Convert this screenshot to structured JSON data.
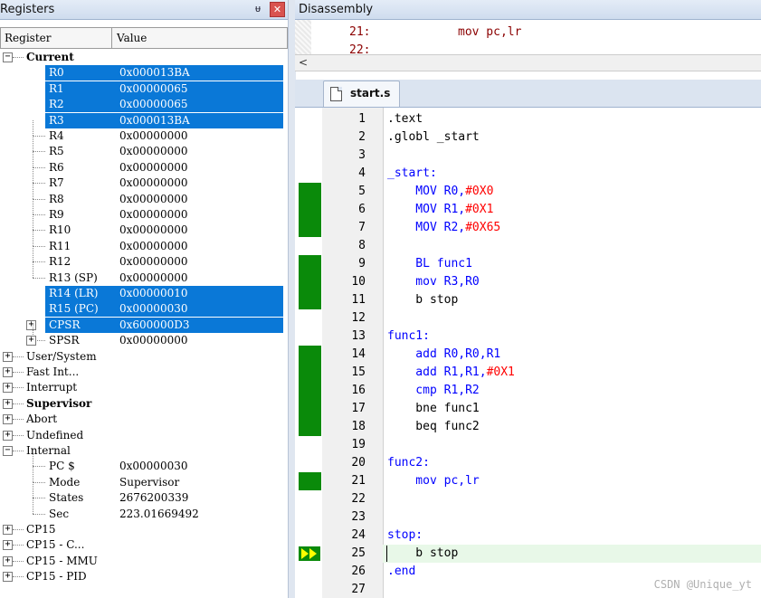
{
  "registers_panel": {
    "title": "Registers",
    "pin_glyph": "ᵾ",
    "close_glyph": "✕",
    "columns": {
      "register": "Register",
      "value": "Value"
    }
  },
  "tree": [
    {
      "name": "Current",
      "value": "",
      "bold": true,
      "expander": "−",
      "level": 1,
      "selected": false
    },
    {
      "name": "R0",
      "value": "0x000013BA",
      "level": 2,
      "selected": true
    },
    {
      "name": "R1",
      "value": "0x00000065",
      "level": 2,
      "selected": true
    },
    {
      "name": "R2",
      "value": "0x00000065",
      "level": 2,
      "selected": true
    },
    {
      "name": "R3",
      "value": "0x000013BA",
      "level": 2,
      "selected": true
    },
    {
      "name": "R4",
      "value": "0x00000000",
      "level": 2,
      "selected": false
    },
    {
      "name": "R5",
      "value": "0x00000000",
      "level": 2,
      "selected": false
    },
    {
      "name": "R6",
      "value": "0x00000000",
      "level": 2,
      "selected": false
    },
    {
      "name": "R7",
      "value": "0x00000000",
      "level": 2,
      "selected": false
    },
    {
      "name": "R8",
      "value": "0x00000000",
      "level": 2,
      "selected": false
    },
    {
      "name": "R9",
      "value": "0x00000000",
      "level": 2,
      "selected": false
    },
    {
      "name": "R10",
      "value": "0x00000000",
      "level": 2,
      "selected": false
    },
    {
      "name": "R11",
      "value": "0x00000000",
      "level": 2,
      "selected": false
    },
    {
      "name": "R12",
      "value": "0x00000000",
      "level": 2,
      "selected": false
    },
    {
      "name": "R13 (SP)",
      "value": "0x00000000",
      "level": 2,
      "selected": false
    },
    {
      "name": "R14 (LR)",
      "value": "0x00000010",
      "level": 2,
      "selected": true
    },
    {
      "name": "R15 (PC)",
      "value": "0x00000030",
      "level": 2,
      "selected": true
    },
    {
      "name": "CPSR",
      "value": "0x600000D3",
      "level": 2,
      "selected": true,
      "expander": "+"
    },
    {
      "name": "SPSR",
      "value": "0x00000000",
      "level": 2,
      "selected": false,
      "expander": "+"
    },
    {
      "name": "User/System",
      "value": "",
      "level": 1,
      "expander": "+"
    },
    {
      "name": "Fast Int...",
      "value": "",
      "level": 1,
      "expander": "+"
    },
    {
      "name": "Interrupt",
      "value": "",
      "level": 1,
      "expander": "+"
    },
    {
      "name": "Supervisor",
      "value": "",
      "level": 1,
      "expander": "+",
      "bold": true
    },
    {
      "name": "Abort",
      "value": "",
      "level": 1,
      "expander": "+"
    },
    {
      "name": "Undefined",
      "value": "",
      "level": 1,
      "expander": "+"
    },
    {
      "name": "Internal",
      "value": "",
      "level": 1,
      "expander": "−"
    },
    {
      "name": "PC  $",
      "value": "0x00000030",
      "level": 2,
      "selected": false
    },
    {
      "name": "Mode",
      "value": "Supervisor",
      "level": 2,
      "selected": false
    },
    {
      "name": "States",
      "value": "2676200339",
      "level": 2,
      "selected": false
    },
    {
      "name": "Sec",
      "value": "223.01669492",
      "level": 2,
      "selected": false
    },
    {
      "name": "CP15",
      "value": "",
      "level": 1,
      "expander": "+"
    },
    {
      "name": "CP15 - C...",
      "value": "",
      "level": 1,
      "expander": "+"
    },
    {
      "name": "CP15 - MMU",
      "value": "",
      "level": 1,
      "expander": "+"
    },
    {
      "name": "CP15 - PID",
      "value": "",
      "level": 1,
      "expander": "+"
    }
  ],
  "disassembly": {
    "title": "Disassembly",
    "lines": [
      {
        "num": "21:",
        "code": "mov pc,lr"
      },
      {
        "num": "22:",
        "code": ""
      }
    ],
    "scroll_left_glyph": "<"
  },
  "editor": {
    "tab_label": "start.s",
    "lines": [
      {
        "n": "1",
        "covered": false,
        "tokens": [
          [
            ".text",
            "#000"
          ]
        ]
      },
      {
        "n": "2",
        "covered": false,
        "tokens": [
          [
            ".globl _start",
            "#000"
          ]
        ]
      },
      {
        "n": "3",
        "covered": false,
        "tokens": []
      },
      {
        "n": "4",
        "covered": false,
        "tokens": [
          [
            "_start:",
            "#0000ff"
          ]
        ]
      },
      {
        "n": "5",
        "covered": true,
        "tokens": [
          [
            "    MOV R0,",
            "#0000ff"
          ],
          [
            "#0X0",
            "#ff0000"
          ]
        ]
      },
      {
        "n": "6",
        "covered": true,
        "tokens": [
          [
            "    MOV R1,",
            "#0000ff"
          ],
          [
            "#0X1",
            "#ff0000"
          ]
        ]
      },
      {
        "n": "7",
        "covered": true,
        "tokens": [
          [
            "    MOV R2,",
            "#0000ff"
          ],
          [
            "#0X65",
            "#ff0000"
          ]
        ]
      },
      {
        "n": "8",
        "covered": false,
        "tokens": []
      },
      {
        "n": "9",
        "covered": true,
        "tokens": [
          [
            "    BL func1",
            "#0000ff"
          ]
        ]
      },
      {
        "n": "10",
        "covered": true,
        "tokens": [
          [
            "    mov R3,R0",
            "#0000ff"
          ]
        ]
      },
      {
        "n": "11",
        "covered": true,
        "tokens": [
          [
            "    b stop",
            "#000"
          ]
        ]
      },
      {
        "n": "12",
        "covered": false,
        "tokens": []
      },
      {
        "n": "13",
        "covered": false,
        "tokens": [
          [
            "func1:",
            "#0000ff"
          ]
        ]
      },
      {
        "n": "14",
        "covered": true,
        "tokens": [
          [
            "    add R0,R0,R1",
            "#0000ff"
          ]
        ]
      },
      {
        "n": "15",
        "covered": true,
        "tokens": [
          [
            "    add R1,R1,",
            "#0000ff"
          ],
          [
            "#0X1",
            "#ff0000"
          ]
        ]
      },
      {
        "n": "16",
        "covered": true,
        "tokens": [
          [
            "    cmp R1,R2",
            "#0000ff"
          ]
        ]
      },
      {
        "n": "17",
        "covered": true,
        "tokens": [
          [
            "    bne func1",
            "#000"
          ]
        ]
      },
      {
        "n": "18",
        "covered": true,
        "tokens": [
          [
            "    beq func2",
            "#000"
          ]
        ]
      },
      {
        "n": "19",
        "covered": false,
        "tokens": []
      },
      {
        "n": "20",
        "covered": false,
        "tokens": [
          [
            "func2:",
            "#0000ff"
          ]
        ]
      },
      {
        "n": "21",
        "covered": true,
        "tokens": [
          [
            "    mov pc,lr",
            "#0000ff"
          ]
        ]
      },
      {
        "n": "22",
        "covered": false,
        "tokens": []
      },
      {
        "n": "23",
        "covered": false,
        "tokens": []
      },
      {
        "n": "24",
        "covered": false,
        "tokens": [
          [
            "stop:",
            "#0000ff"
          ]
        ]
      },
      {
        "n": "25",
        "covered": false,
        "current": true,
        "tokens": [
          [
            "    b stop",
            "#000"
          ]
        ]
      },
      {
        "n": "26",
        "covered": false,
        "tokens": [
          [
            ".end",
            "#0000ff"
          ]
        ]
      },
      {
        "n": "27",
        "covered": false,
        "tokens": []
      }
    ]
  },
  "watermark": "CSDN @Unique_yt",
  "colors": {
    "selection": "#0a78d7",
    "coverage": "#0a8a0a",
    "current_line": "#e8f8e8"
  }
}
